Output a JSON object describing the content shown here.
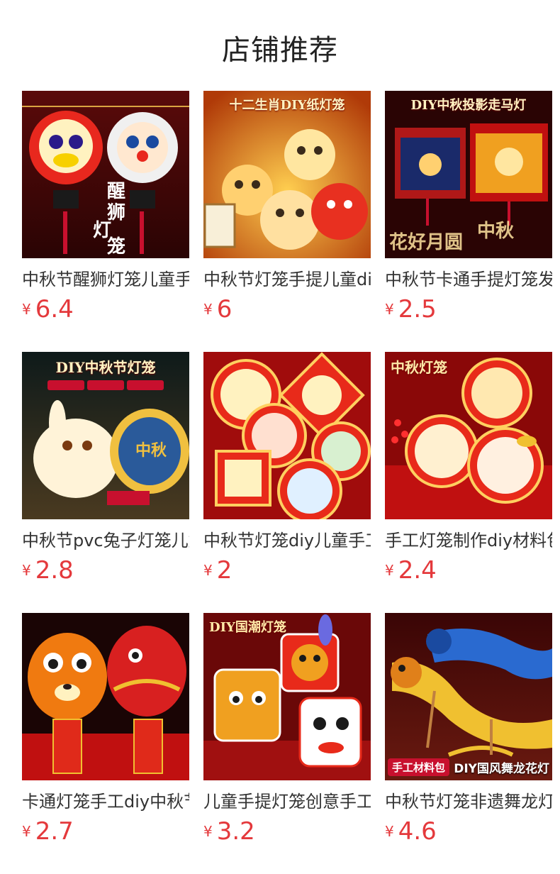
{
  "section": {
    "title": "店铺推荐"
  },
  "products": [
    {
      "name": "中秋节醒狮灯笼儿童手提",
      "currency": "¥",
      "price": "6.4",
      "thumb_colors": [
        "#5a0a0a",
        "#c8102e"
      ],
      "caption": "醒狮灯笼",
      "tag": "",
      "tag2": ""
    },
    {
      "name": "中秋节灯笼手提儿童diy",
      "currency": "¥",
      "price": "6",
      "thumb_colors": [
        "#f0a030",
        "#e86010"
      ],
      "caption": "十二生肖DIY纸灯笼",
      "tag": "",
      "tag2": ""
    },
    {
      "name": "中秋节卡通手提灯笼发光",
      "currency": "¥",
      "price": "2.5",
      "thumb_colors": [
        "#3a0505",
        "#a00a0a"
      ],
      "caption": "DIY中秋投影走马灯",
      "tag": "",
      "tag2": ""
    },
    {
      "name": "中秋节pvc兔子灯笼儿童",
      "currency": "¥",
      "price": "2.8",
      "thumb_colors": [
        "#0e1a1a",
        "#5a4020"
      ],
      "caption": "DIY中秋节灯笼",
      "tag": "",
      "tag2": ""
    },
    {
      "name": "中秋节灯笼diy儿童手工",
      "currency": "¥",
      "price": "2",
      "thumb_colors": [
        "#8a0a0a",
        "#d41a1a"
      ],
      "caption": "",
      "tag": "",
      "tag2": ""
    },
    {
      "name": "手工灯笼制作diy材料包",
      "currency": "¥",
      "price": "2.4",
      "thumb_colors": [
        "#6a0505",
        "#c01010"
      ],
      "caption": "中秋灯笼",
      "tag": "",
      "tag2": ""
    },
    {
      "name": "卡通灯笼手工diy中秋节",
      "currency": "¥",
      "price": "2.7",
      "thumb_colors": [
        "#1a0505",
        "#c81010"
      ],
      "caption": "",
      "tag": "",
      "tag2": ""
    },
    {
      "name": "儿童手提灯笼创意手工",
      "currency": "¥",
      "price": "3.2",
      "thumb_colors": [
        "#6a0808",
        "#c0201a"
      ],
      "caption": "DIY国潮灯笼",
      "tag": "",
      "tag2": ""
    },
    {
      "name": "中秋节灯笼非遗舞龙灯",
      "currency": "¥",
      "price": "4.6",
      "thumb_colors": [
        "#3a0505",
        "#7a1510"
      ],
      "caption": "",
      "tag": "手工材料包",
      "tag2": "DIY国风舞龙花灯"
    }
  ]
}
